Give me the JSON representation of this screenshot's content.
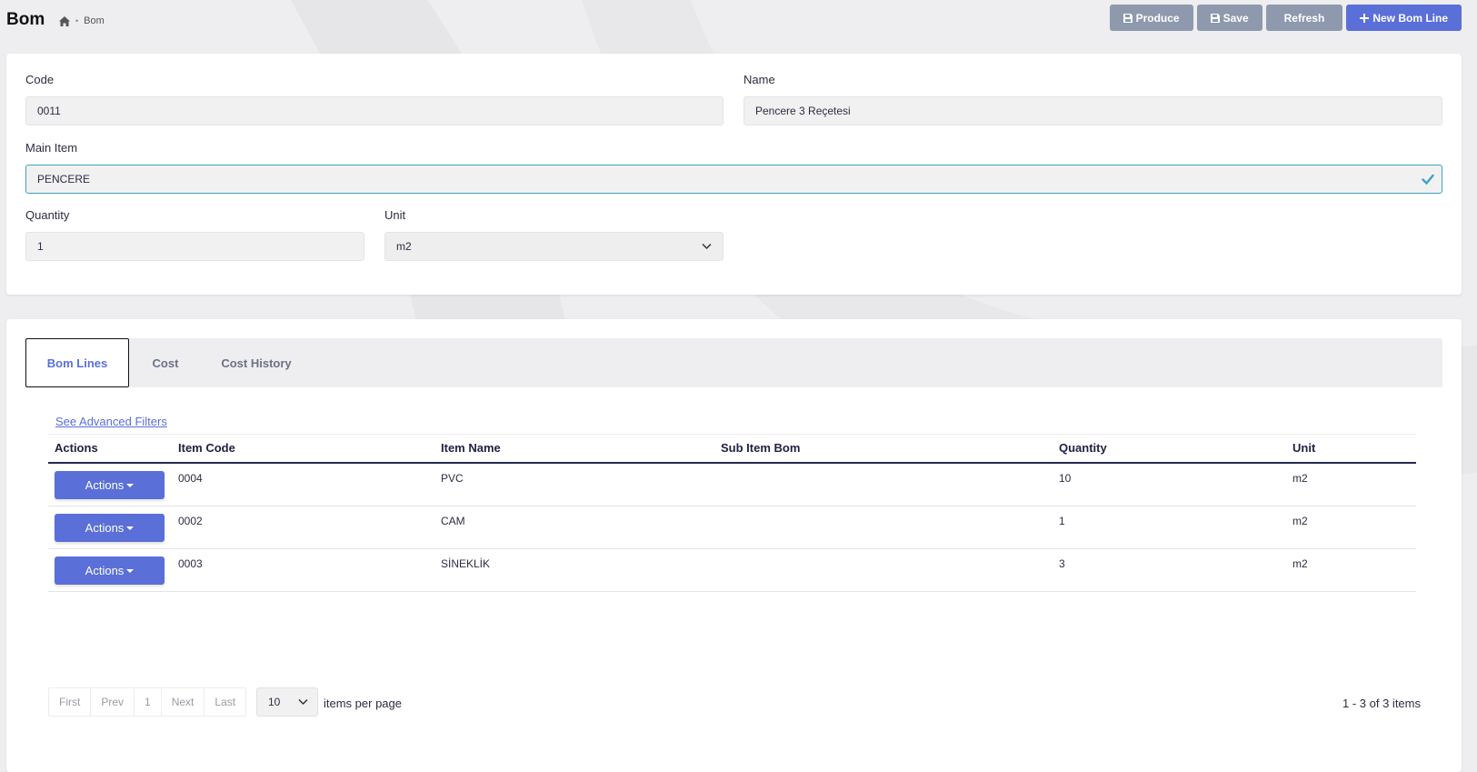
{
  "header": {
    "title": "Bom",
    "breadcrumb": {
      "home_icon": "home-icon",
      "current": "Bom"
    },
    "buttons": {
      "produce": "Produce",
      "save": "Save",
      "refresh": "Refresh",
      "new_bom_line": "New Bom Line"
    }
  },
  "form": {
    "code": {
      "label": "Code",
      "value": "0011"
    },
    "name": {
      "label": "Name",
      "value": "Pencere 3 Reçetesi"
    },
    "main_item": {
      "label": "Main Item",
      "value": "PENCERE"
    },
    "quantity": {
      "label": "Quantity",
      "value": "1"
    },
    "unit": {
      "label": "Unit",
      "value": "m2"
    }
  },
  "tabs": [
    {
      "label": "Bom Lines",
      "active": true
    },
    {
      "label": "Cost",
      "active": false
    },
    {
      "label": "Cost History",
      "active": false
    }
  ],
  "table": {
    "advanced_filters": "See Advanced Filters",
    "headers": {
      "actions": "Actions",
      "item_code": "Item Code",
      "item_name": "Item Name",
      "sub_item_bom": "Sub Item Bom",
      "quantity": "Quantity",
      "unit": "Unit"
    },
    "rows": [
      {
        "action_label": "Actions",
        "item_code": "0004",
        "item_name": "PVC",
        "sub_item_bom": "",
        "quantity": "10",
        "unit": "m2"
      },
      {
        "action_label": "Actions",
        "item_code": "0002",
        "item_name": "CAM",
        "sub_item_bom": "",
        "quantity": "1",
        "unit": "m2"
      },
      {
        "action_label": "Actions",
        "item_code": "0003",
        "item_name": "SİNEKLİK",
        "sub_item_bom": "",
        "quantity": "3",
        "unit": "m2"
      }
    ]
  },
  "pagination": {
    "first": "First",
    "prev": "Prev",
    "page": "1",
    "next": "Next",
    "last": "Last",
    "page_size": "10",
    "items_per_page": "items per page",
    "range": "1 - 3 of 3 items"
  },
  "colors": {
    "accent": "#5a6fd8",
    "button_gray": "#8e99ad",
    "header_line": "#252a52",
    "valid_border": "#3fa2c2"
  }
}
